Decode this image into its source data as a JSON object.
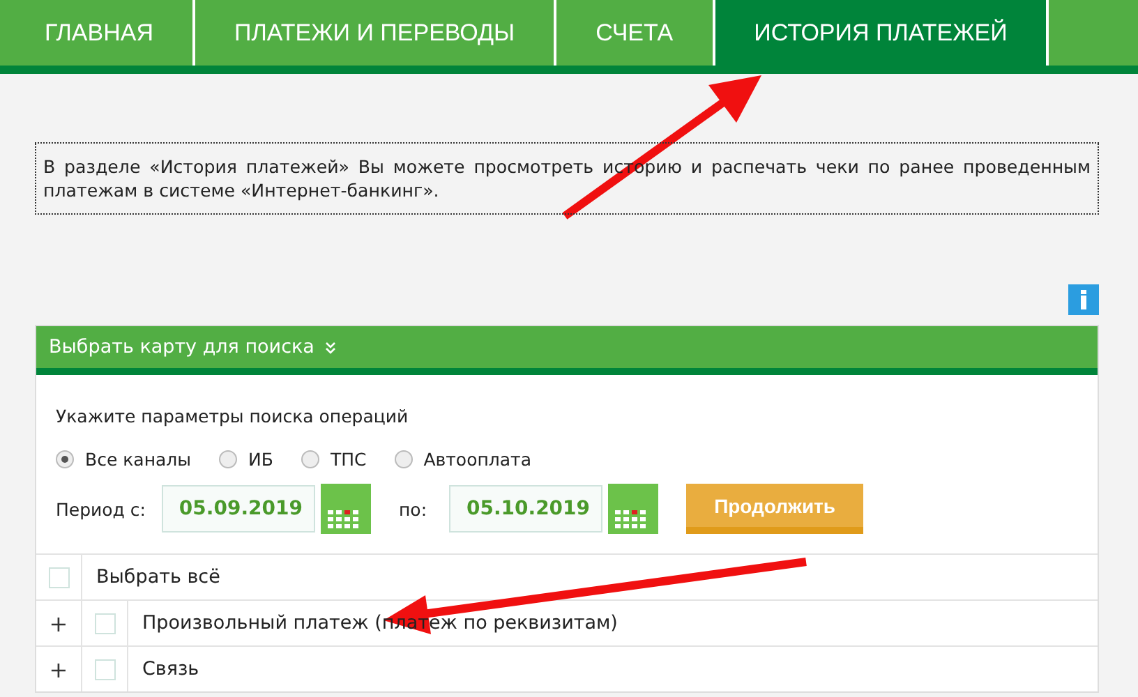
{
  "tabs": [
    {
      "label": "ГЛАВНАЯ",
      "selected": false
    },
    {
      "label": "ПЛАТЕЖИ И ПЕРЕВОДЫ",
      "selected": false
    },
    {
      "label": "СЧЕТА",
      "selected": false
    },
    {
      "label": "ИСТОРИЯ ПЛАТЕЖЕЙ",
      "selected": true
    }
  ],
  "info_text": "В разделе «История платежей» Вы можете просмотреть историю и распечать чеки по ранее проведенным платежам в системе «Интернет-банкинг».",
  "panel": {
    "title": "Выбрать карту для поиска",
    "hint": "Укажите параметры поиска операций",
    "channels": [
      {
        "label": "Все каналы",
        "selected": true
      },
      {
        "label": "ИБ",
        "selected": false
      },
      {
        "label": "ТПС",
        "selected": false
      },
      {
        "label": "Автооплата",
        "selected": false
      }
    ],
    "period_from_label": "Период с:",
    "period_from": "05.09.2019",
    "period_to_label": "по:",
    "period_to": "05.10.2019",
    "submit": "Продолжить"
  },
  "select_all": {
    "label": "Выбрать всё",
    "checked": false
  },
  "categories": [
    {
      "label": "Произвольный платеж (платеж по реквизитам)",
      "checked": false,
      "expanded": false,
      "expander": "+"
    },
    {
      "label": "Связь",
      "checked": false,
      "expanded": false,
      "expander": "+"
    }
  ]
}
